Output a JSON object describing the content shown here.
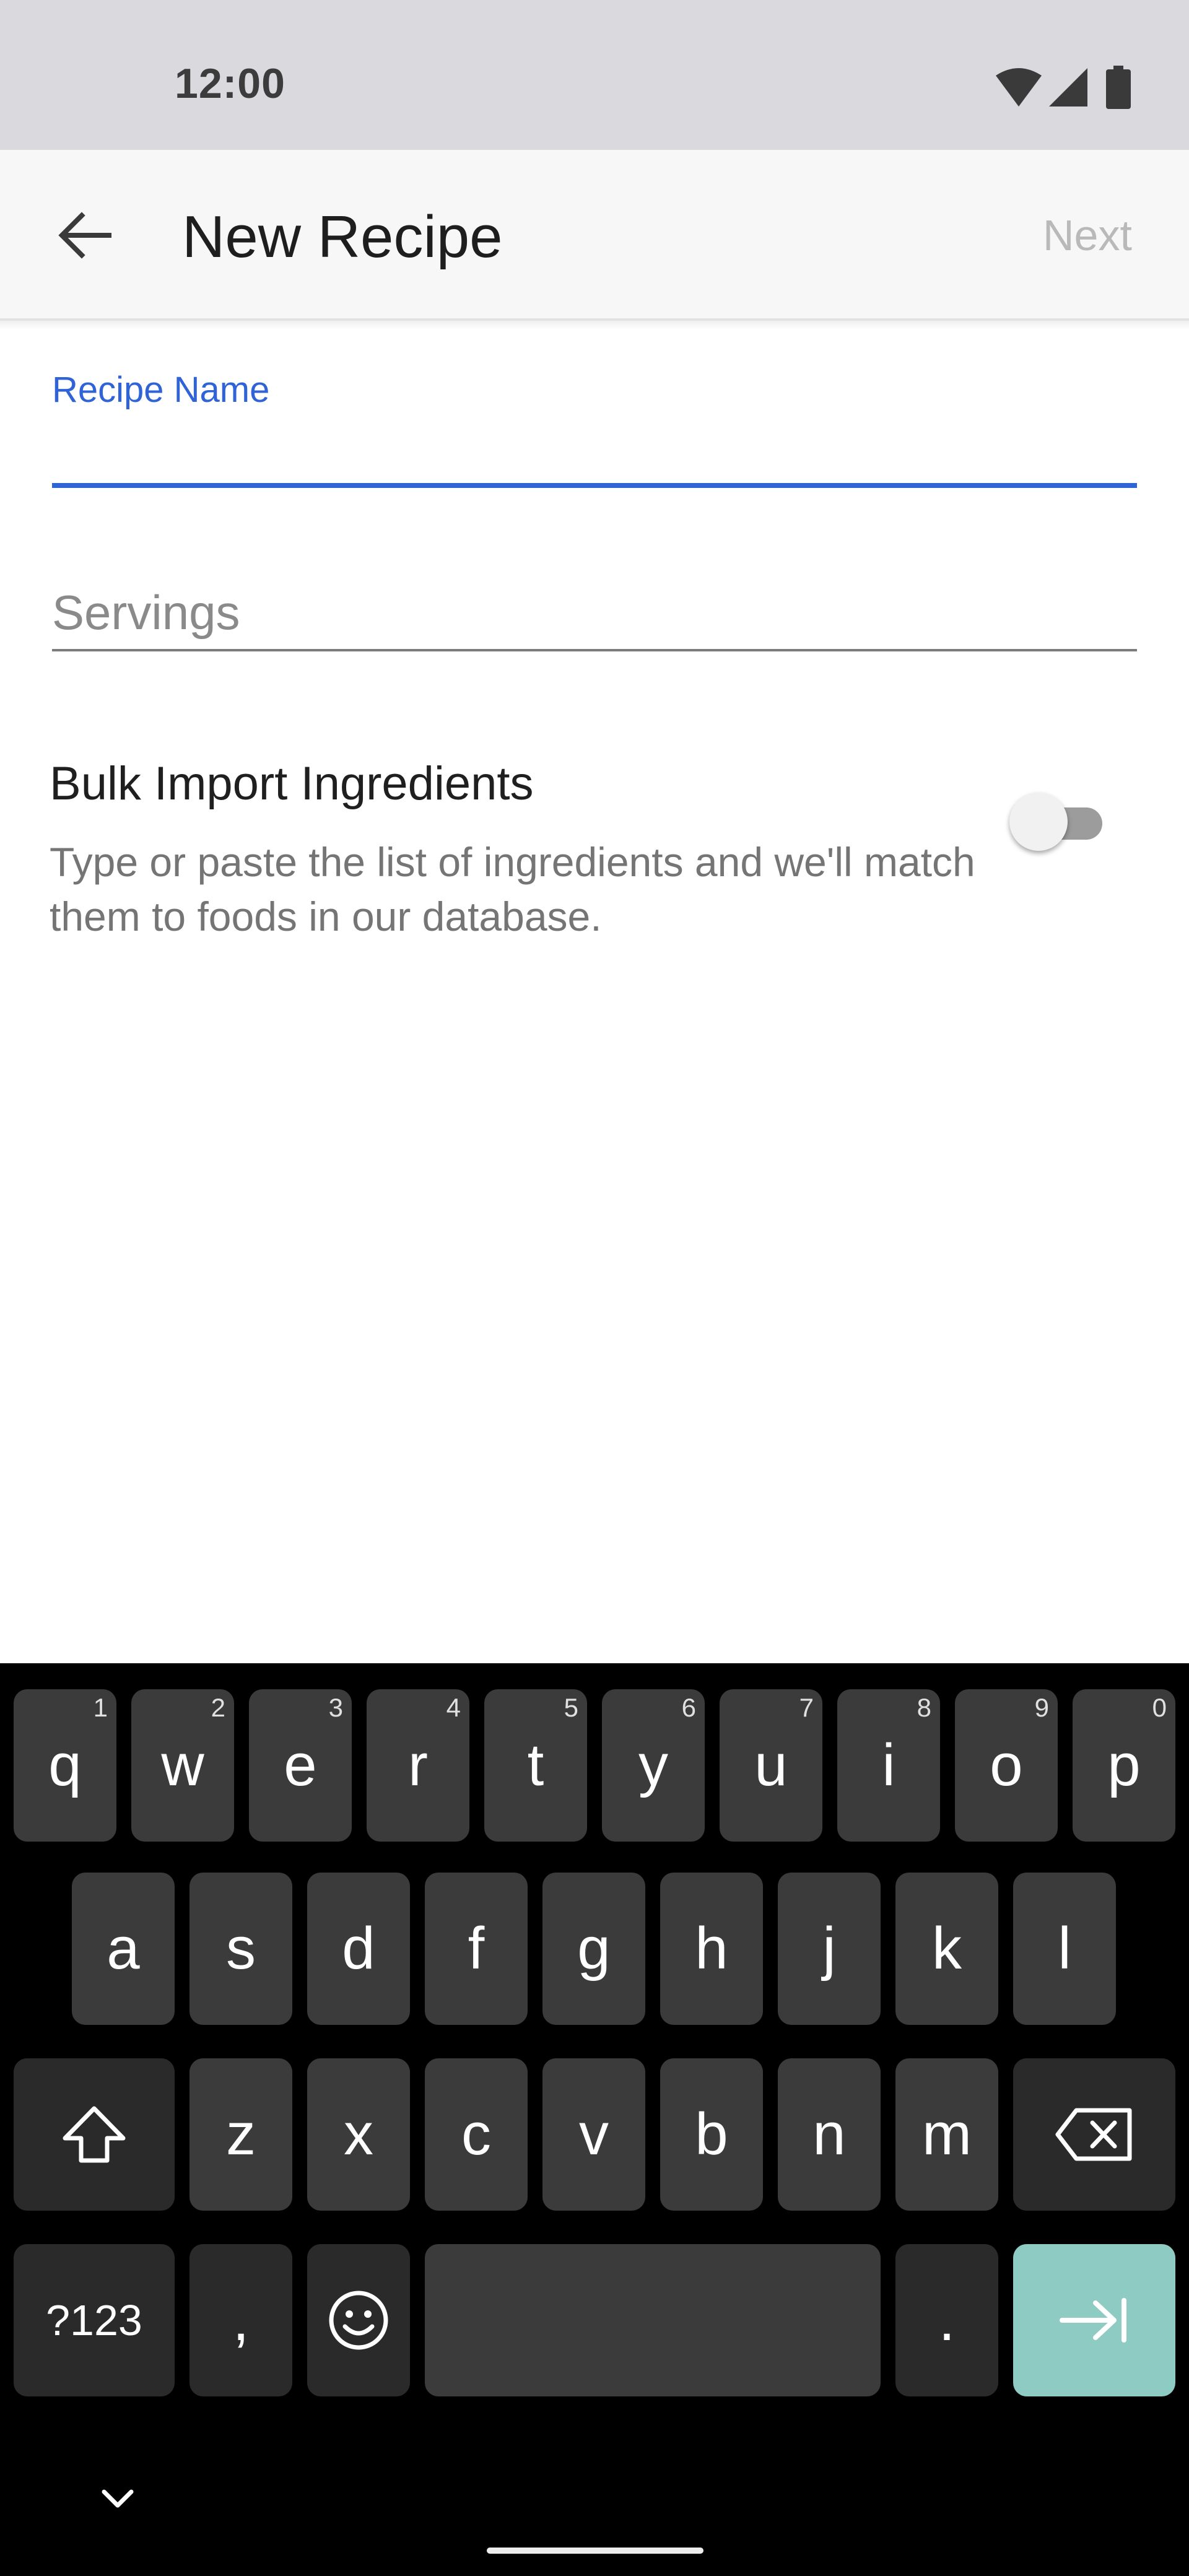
{
  "status_bar": {
    "time": "12:00"
  },
  "app_bar": {
    "title": "New Recipe",
    "next_label": "Next"
  },
  "form": {
    "recipe_name_label": "Recipe Name",
    "recipe_name_value": "",
    "servings_placeholder": "Servings",
    "bulk_import_title": "Bulk Import Ingredients",
    "bulk_import_description": "Type or paste the list of ingredients and we'll match them to foods in our database.",
    "bulk_import_enabled": false
  },
  "keyboard": {
    "row1": [
      {
        "key": "q",
        "hint": "1"
      },
      {
        "key": "w",
        "hint": "2"
      },
      {
        "key": "e",
        "hint": "3"
      },
      {
        "key": "r",
        "hint": "4"
      },
      {
        "key": "t",
        "hint": "5"
      },
      {
        "key": "y",
        "hint": "6"
      },
      {
        "key": "u",
        "hint": "7"
      },
      {
        "key": "i",
        "hint": "8"
      },
      {
        "key": "o",
        "hint": "9"
      },
      {
        "key": "p",
        "hint": "0"
      }
    ],
    "row2": [
      "a",
      "s",
      "d",
      "f",
      "g",
      "h",
      "j",
      "k",
      "l"
    ],
    "row3": [
      "z",
      "x",
      "c",
      "v",
      "b",
      "n",
      "m"
    ],
    "symbols_label": "?123",
    "comma_label": ",",
    "period_label": ".",
    "icons": {
      "shift": "shift-icon",
      "backspace": "backspace-icon",
      "emoji": "emoji-icon",
      "action": "tab-next-icon",
      "collapse": "chevron-down-icon"
    },
    "colors": {
      "background": "#000000",
      "key": "#3b3b3b",
      "function_key": "#2a2a2a",
      "action_key": "#8ecbc2"
    }
  },
  "colors": {
    "accent": "#2f63d6",
    "app_bar": "#f7f7f7",
    "status_bar": "#dad9de"
  }
}
